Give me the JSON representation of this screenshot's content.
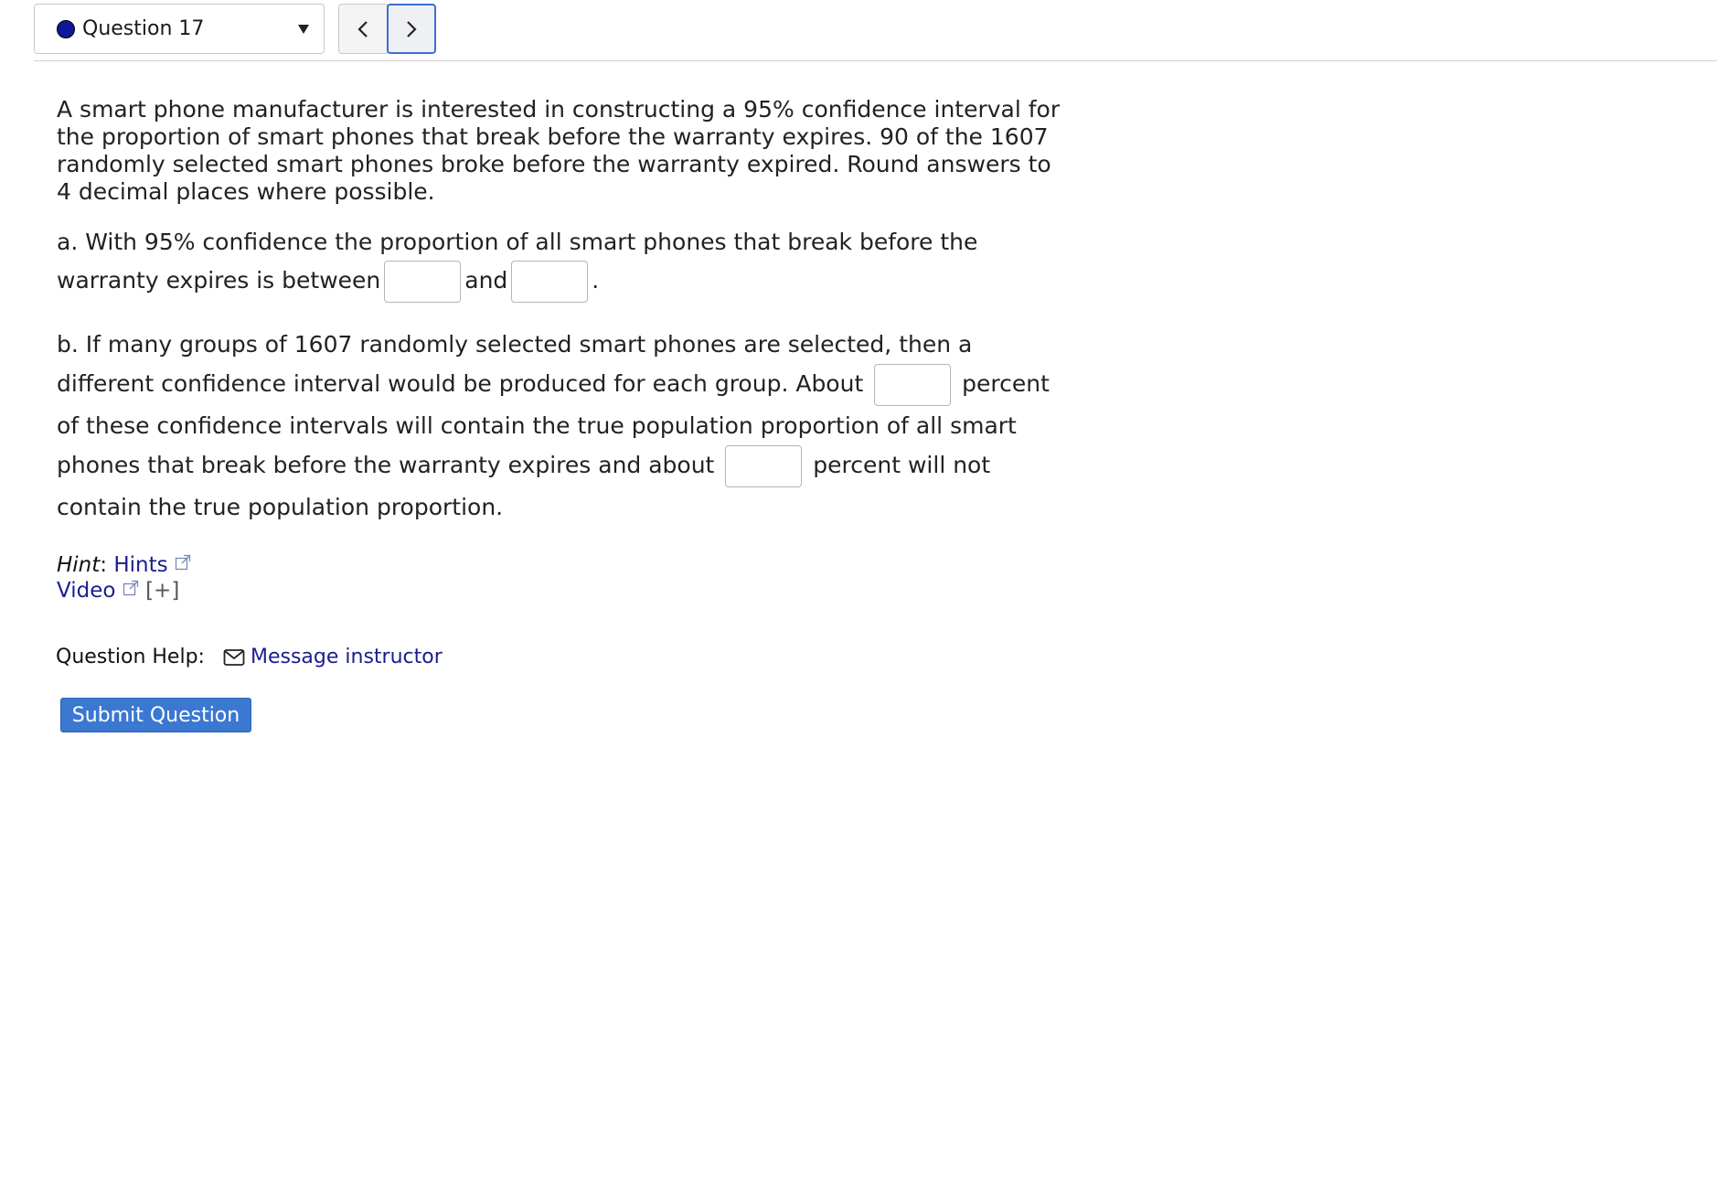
{
  "header": {
    "question_label": "Question 17",
    "prev_glyph": "‹",
    "next_glyph": "›",
    "status_dot_color": "#0a1a9a"
  },
  "question": {
    "intro": "A smart phone manufacturer is interested in constructing a 95% confidence interval for the proportion of smart phones that break before the warranty expires. 90 of the 1607 randomly selected smart phones broke before the warranty expired. Round answers to 4 decimal places where possible.",
    "part_a": {
      "text_1": "a.  With 95% confidence the proportion of all smart phones that break before the warranty expires is between",
      "text_2": "and",
      "text_3": ".",
      "input_1_value": "",
      "input_2_value": ""
    },
    "part_b": {
      "text_1": "b.  If many groups of 1607 randomly selected smart phones are selected, then a different confidence interval would be produced for each group. About",
      "text_2": "percent of these confidence intervals will contain the true population proportion of all smart phones that break before the warranty expires and about",
      "text_3": "percent will not contain the true population proportion.",
      "input_1_value": "",
      "input_2_value": ""
    }
  },
  "hints": {
    "hint_label": "Hint",
    "hint_colon": ":",
    "hints_link": "Hints",
    "video_link": "Video",
    "expand": "[+]"
  },
  "help": {
    "label": "Question Help:",
    "message_link": "Message instructor"
  },
  "submit": {
    "label": "Submit Question",
    "color": "#3a78d1"
  },
  "colors": {
    "link": "#1a1e8c",
    "text": "#222222",
    "focus_border": "#3b6fcf"
  }
}
